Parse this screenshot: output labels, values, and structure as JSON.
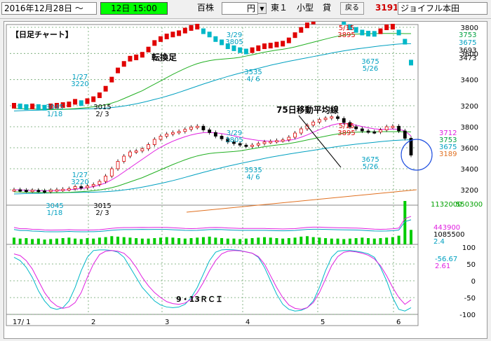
{
  "toolbar": {
    "date_range": "2016年12月28日 ～",
    "time": "12日 15:00",
    "unit_label": "百株",
    "price_unit": "円",
    "market": "東１",
    "size": "小型",
    "lending": "貸",
    "back_button": "戻る",
    "code": "3191",
    "company": "ジョイフル本田"
  },
  "chart_data": {
    "type": "line",
    "title": "【日足チャート】",
    "x_labels": [
      "17/ 1",
      "2",
      "3",
      "4",
      "5",
      "6"
    ],
    "upper_panel": {
      "annotation": "転換足",
      "ylim": [
        3200,
        3800
      ],
      "y_ticks": [
        3800,
        3600,
        3400,
        3200
      ],
      "right_labels": [
        "3753",
        "3675",
        "3693",
        "3473"
      ],
      "callouts": [
        {
          "date": "1/27",
          "value": "3220"
        },
        {
          "date": "1/18",
          "value": "3045"
        },
        {
          "date": "2/ 3",
          "value": "3015"
        },
        {
          "date": "3/29",
          "value": "3805"
        },
        {
          "date": "4/ 6",
          "value": "3535"
        },
        {
          "date": "5/15",
          "value": "3895"
        },
        {
          "date": "5/26",
          "value": "3675"
        }
      ],
      "series": [
        {
          "name": "price",
          "values": [
            3200,
            3195,
            3190,
            3195,
            3190,
            3185,
            3195,
            3200,
            3205,
            3210,
            3230,
            3220,
            3235,
            3250,
            3280,
            3330,
            3400,
            3470,
            3520,
            3560,
            3570,
            3590,
            3630,
            3680,
            3710,
            3730,
            3745,
            3755,
            3775,
            3795,
            3805,
            3770,
            3745,
            3710,
            3685,
            3655,
            3640,
            3625,
            3615,
            3625,
            3640,
            3655,
            3660,
            3668,
            3675,
            3700,
            3740,
            3780,
            3815,
            3845,
            3868,
            3882,
            3895,
            3878,
            3840,
            3800,
            3780,
            3760,
            3752,
            3750,
            3770,
            3800,
            3805,
            3760,
            3690,
            3530
          ]
        },
        {
          "name": "ma25",
          "values": [
            3180,
            3178,
            3176,
            3175,
            3173,
            3172,
            3172,
            3172,
            3173,
            3175,
            3178,
            3182,
            3186,
            3192,
            3198,
            3208,
            3220,
            3235,
            3255,
            3275,
            3295,
            3315,
            3340,
            3365,
            3390,
            3415,
            3440,
            3463,
            3485,
            3505,
            3522,
            3535,
            3545,
            3552,
            3556,
            3560,
            3564,
            3570,
            3580,
            3590,
            3600,
            3610,
            3618,
            3626,
            3632,
            3640,
            3650,
            3662,
            3674,
            3686,
            3698,
            3710,
            3722,
            3732,
            3740,
            3745,
            3748,
            3750,
            3752,
            3752,
            3753,
            3753,
            3753,
            3753,
            3752,
            3752
          ]
        },
        {
          "name": "ma75",
          "values": [
            3160,
            3162,
            3164,
            3165,
            3166,
            3168,
            3170,
            3171,
            3172,
            3173,
            3174,
            3175,
            3176,
            3177,
            3179,
            3182,
            3186,
            3191,
            3198,
            3206,
            3215,
            3225,
            3236,
            3248,
            3260,
            3273,
            3287,
            3302,
            3318,
            3334,
            3350,
            3366,
            3381,
            3396,
            3410,
            3424,
            3437,
            3450,
            3462,
            3474,
            3486,
            3498,
            3510,
            3520,
            3530,
            3540,
            3549,
            3558,
            3567,
            3576,
            3585,
            3594,
            3603,
            3612,
            3620,
            3627,
            3634,
            3640,
            3646,
            3652,
            3658,
            3663,
            3668,
            3672,
            3675,
            3675
          ]
        }
      ]
    },
    "lower_panel": {
      "annotation": "75日移動平均線",
      "ylim": [
        3200,
        3800
      ],
      "y_ticks": [
        3800,
        3600,
        3400,
        3200
      ],
      "right_labels": [
        "3712",
        "3753",
        "3675",
        "3189"
      ],
      "callouts": [
        {
          "date": "1/27",
          "value": "3220"
        },
        {
          "date": "1/18",
          "value": "3045"
        },
        {
          "date": "2/ 3",
          "value": "3015"
        },
        {
          "date": "3/29",
          "value": "3805"
        },
        {
          "date": "4/ 6",
          "value": "3535"
        },
        {
          "date": "5/15",
          "value": "3895"
        },
        {
          "date": "5/26",
          "value": "3675"
        }
      ],
      "candles": [
        3200,
        3195,
        3190,
        3195,
        3190,
        3185,
        3195,
        3200,
        3205,
        3210,
        3230,
        3220,
        3235,
        3250,
        3280,
        3330,
        3400,
        3470,
        3520,
        3560,
        3570,
        3590,
        3630,
        3680,
        3710,
        3730,
        3745,
        3755,
        3775,
        3795,
        3805,
        3770,
        3745,
        3710,
        3685,
        3655,
        3640,
        3625,
        3615,
        3625,
        3640,
        3655,
        3660,
        3668,
        3675,
        3700,
        3740,
        3780,
        3815,
        3845,
        3868,
        3882,
        3895,
        3878,
        3840,
        3800,
        3780,
        3760,
        3752,
        3750,
        3770,
        3800,
        3805,
        3760,
        3690,
        3530
      ],
      "ma_short": [
        3200,
        3198,
        3195,
        3193,
        3192,
        3190,
        3190,
        3192,
        3196,
        3200,
        3206,
        3212,
        3220,
        3230,
        3245,
        3265,
        3295,
        3330,
        3370,
        3410,
        3450,
        3490,
        3530,
        3570,
        3605,
        3635,
        3662,
        3685,
        3705,
        3722,
        3735,
        3743,
        3745,
        3742,
        3735,
        3725,
        3713,
        3700,
        3688,
        3678,
        3670,
        3665,
        3662,
        3662,
        3664,
        3670,
        3682,
        3700,
        3722,
        3748,
        3772,
        3795,
        3815,
        3828,
        3830,
        3825,
        3815,
        3802,
        3790,
        3780,
        3775,
        3775,
        3778,
        3775,
        3760,
        3712
      ]
    },
    "trend_line": {
      "values": [
        3189
      ]
    },
    "volume_panel": {
      "labels": [
        "1132000",
        "550300",
        "443900",
        "1085500",
        "2.4"
      ],
      "values": [
        14,
        12,
        13,
        11,
        12,
        10,
        11,
        12,
        13,
        14,
        12,
        11,
        13,
        12,
        14,
        15,
        17,
        16,
        15,
        14,
        13,
        12,
        12,
        13,
        14,
        15,
        14,
        13,
        12,
        13,
        14,
        15,
        16,
        14,
        13,
        12,
        12,
        11,
        12,
        13,
        14,
        15,
        14,
        13,
        12,
        13,
        14,
        16,
        17,
        15,
        14,
        13,
        12,
        12,
        11,
        12,
        13,
        14,
        13,
        12,
        13,
        14,
        15,
        18,
        90,
        30
      ]
    },
    "rci_panel": {
      "label": "9・13ＲＣＩ",
      "ylim": [
        -100,
        100
      ],
      "y_ticks": [
        "100",
        "50",
        "0",
        "-50",
        "-100"
      ],
      "readouts": [
        "-56.67",
        "2.61"
      ],
      "rci9": [
        70,
        60,
        40,
        10,
        -30,
        -60,
        -80,
        -85,
        -80,
        -60,
        -20,
        30,
        70,
        90,
        92,
        92,
        90,
        85,
        70,
        40,
        10,
        -20,
        -40,
        -60,
        -72,
        -78,
        -80,
        -78,
        -70,
        -50,
        -20,
        20,
        60,
        85,
        92,
        93,
        92,
        90,
        86,
        82,
        70,
        40,
        0,
        -40,
        -70,
        -85,
        -90,
        -88,
        -80,
        -60,
        -20,
        30,
        70,
        88,
        90,
        90,
        88,
        85,
        80,
        70,
        40,
        0,
        -50,
        -85,
        -90,
        -80
      ],
      "rci13": [
        80,
        75,
        60,
        35,
        0,
        -35,
        -60,
        -75,
        -82,
        -78,
        -65,
        -35,
        10,
        50,
        78,
        88,
        90,
        88,
        82,
        65,
        40,
        10,
        -15,
        -35,
        -50,
        -62,
        -68,
        -70,
        -66,
        -55,
        -35,
        -5,
        30,
        60,
        80,
        88,
        90,
        89,
        86,
        82,
        72,
        50,
        15,
        -20,
        -50,
        -72,
        -82,
        -85,
        -80,
        -65,
        -35,
        5,
        45,
        72,
        85,
        88,
        86,
        82,
        76,
        65,
        45,
        15,
        -20,
        -50,
        -70,
        -56.67
      ]
    }
  }
}
